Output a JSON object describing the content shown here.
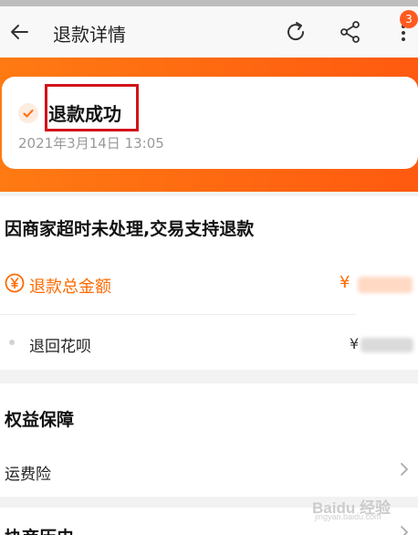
{
  "header": {
    "title": "退款详情",
    "badge_count": "3",
    "icons": [
      "back-arrow-icon",
      "refresh-icon",
      "share-icon",
      "more-vertical-icon"
    ]
  },
  "status": {
    "text": "退款成功",
    "time": "2021年3月14日 13:05",
    "icon": "check-icon"
  },
  "refund": {
    "reason": "因商家超时未处理,交易支持退款",
    "total_label": "退款总金额",
    "currency_symbol": "¥",
    "return_label": "退回花呗",
    "return_symbol": "¥"
  },
  "rights": {
    "title": "权益保障",
    "items": [
      {
        "label": "运费险"
      }
    ]
  },
  "history": {
    "title": "协商历史"
  },
  "watermark": {
    "text": "Baidu 经验",
    "sub": "jingyan.baidu.com"
  },
  "colors": {
    "accent": "#ff6a00",
    "highlight_box": "#d2121a",
    "badge": "#ff5a1f"
  }
}
